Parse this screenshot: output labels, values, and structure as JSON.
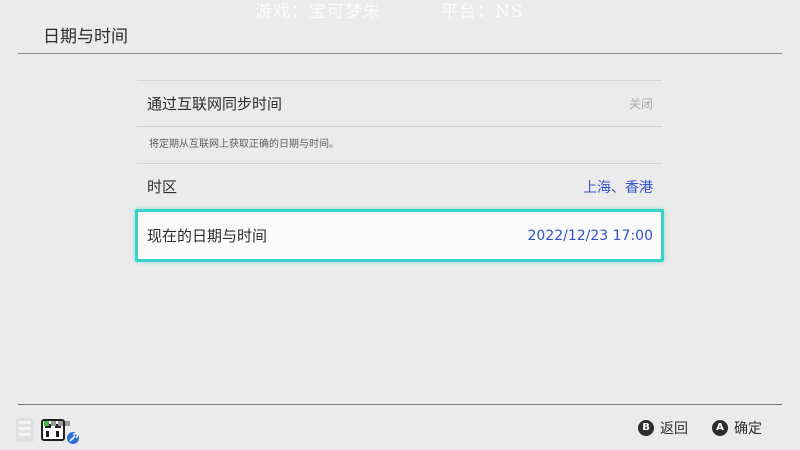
{
  "watermark": {
    "game": "游戏：宝可梦朱",
    "platform": "平台：NS"
  },
  "header": {
    "title": "日期与时间"
  },
  "settings": {
    "sync": {
      "label": "通过互联网同步时间",
      "value": "关闭",
      "description": "将定期从互联网上获取正确的日期与时间。"
    },
    "timezone": {
      "label": "时区",
      "value": "上海、香港"
    },
    "current": {
      "label": "现在的日期与时间",
      "value": "2022/12/23 17:00"
    }
  },
  "footer": {
    "controller_icon": "joycon-controller-icon",
    "back": {
      "button": "B",
      "label": "返回"
    },
    "confirm": {
      "button": "A",
      "label": "确定"
    }
  },
  "colors": {
    "accent_selection": "#37d2c9",
    "value_blue": "#3552c9",
    "background": "#ebebeb"
  }
}
